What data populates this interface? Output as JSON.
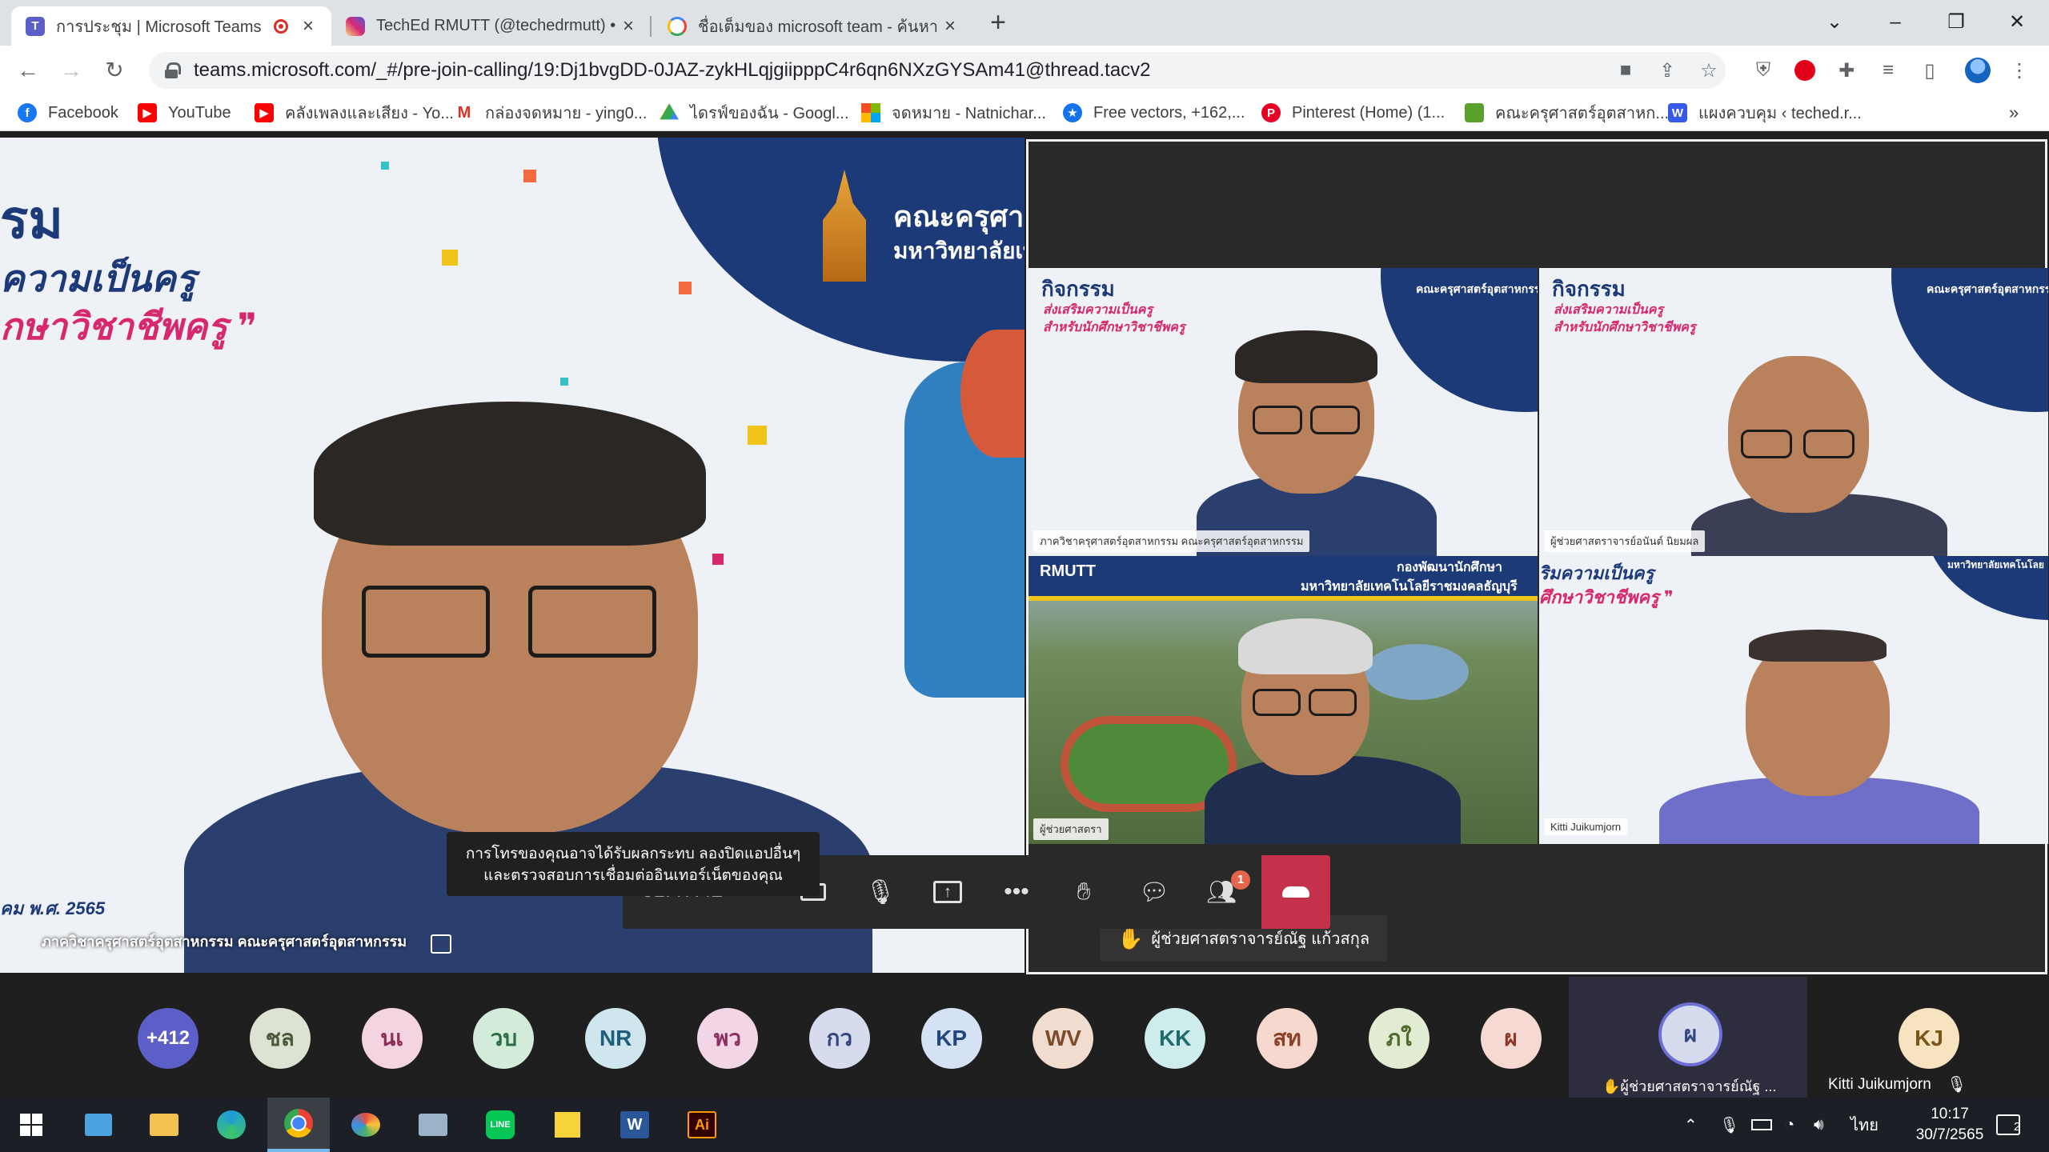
{
  "browser": {
    "tabs": [
      {
        "title": "การประชุม | Microsoft Teams",
        "icon": "teams-icon"
      },
      {
        "title": "TechEd RMUTT (@techedrmutt) •",
        "icon": "instagram-icon"
      },
      {
        "title": "ชื่อเต็มของ microsoft team - ค้นหา",
        "icon": "google-icon"
      }
    ],
    "url": "teams.microsoft.com/_#/pre-join-calling/19:Dj1bvgDD-0JAZ-zykHLqjgiipppC4r6qn6NXzGYSAm41@thread.tacv2",
    "bookmarks": [
      {
        "label": "Facebook",
        "icon": "facebook-icon",
        "color": "#1877f2"
      },
      {
        "label": "YouTube",
        "icon": "youtube-icon",
        "color": "#ff0000"
      },
      {
        "label": "คลังเพลงและเสียง - Yo...",
        "icon": "youtube-icon",
        "color": "#ff0000"
      },
      {
        "label": "กล่องจดหมาย - ying0...",
        "icon": "gmail-icon",
        "color": "#d93025"
      },
      {
        "label": "ไดรฟ์ของฉัน - Googl...",
        "icon": "google-drive-icon",
        "color": "#1fa463"
      },
      {
        "label": "จดหมาย - Natnichar...",
        "icon": "microsoft-icon",
        "color": "#f25022"
      },
      {
        "label": "Free vectors, +162,...",
        "icon": "freepik-icon",
        "color": "#1273eb"
      },
      {
        "label": "Pinterest (Home) (1...",
        "icon": "pinterest-icon",
        "color": "#e60023"
      },
      {
        "label": "คณะครุศาสตร์อุตสาหก...",
        "icon": "bookmark-page-icon",
        "color": "#5aa02c"
      },
      {
        "label": "แผงควบคุม ‹ teched.r...",
        "icon": "wordpress-icon",
        "color": "#3858e9"
      }
    ],
    "more_bookmarks": "»"
  },
  "meeting": {
    "speaker_name": "ภาควิชาครุศาสตร์อุตสาหกรรม คณะครุศาสตร์อุตสาหกรรม",
    "speaker_poster": {
      "title_fragment": "รม",
      "quote_line1": "ความเป็นครู",
      "quote_line2": "กษาวิชาชีพครู ❞",
      "faculty": "คณะครุศาสตร",
      "university": "มหาวิทยาลัยเทค",
      "date_fragment": "คม พ.ศ. 2565"
    },
    "gallery": [
      {
        "name": "ภาควิชาครุศาสตร์อุตสาหกรรม คณะครุศาสตร์อุตสาหกรรม"
      },
      {
        "name": "ผู้ช่วยศาสตราจารย์อนันต์ นิยมผล"
      },
      {
        "name": "ผู้ช่วยศาสตรา"
      },
      {
        "name": "Kitti Juikumjorn"
      }
    ],
    "gallery_poster": {
      "title": "กิจกรรม",
      "quote_line1": "ส่งเสริมความเป็นครู",
      "quote_line2": "สำหรับนักศึกษาวิชาชีพครู",
      "faculty": "คณะครุศาสตร์อุตสาหกรรม",
      "rmutt_label": "RMUTT",
      "rmutt_dept": "กองพัฒนานักศึกษา",
      "rmutt_university": "มหาวิทยาลัยเทคโนโลยีราชมงคลธัญบุรี",
      "tile4_line1": "ริมความเป็นครู",
      "tile4_line2": "ศึกษาวิชาชีพครู ❞",
      "tile4_faculty": "มหาวิทยาลัยเทคโนโลย"
    },
    "raise_hand_toast": "ผู้ช่วยศาสตราจารย์ณัฐ แก้วสกุล",
    "network_tooltip_line1": "การโทรของคุณอาจได้รับผลกระทบ ลองปิดแอปอื่นๆ",
    "network_tooltip_line2": "และตรวจสอบการเชื่อมต่ออินเทอร์เน็ตของคุณ",
    "timer": "01:47:42",
    "participants_badge": "1"
  },
  "participants": [
    {
      "initials": "+412",
      "bg": "#5b5fc7",
      "fg": "#ffffff"
    },
    {
      "initials": "ชล",
      "bg": "#dde3d2",
      "fg": "#4a5a3b"
    },
    {
      "initials": "นเ",
      "bg": "#f5d4e1",
      "fg": "#8a2d57"
    },
    {
      "initials": "วบ",
      "bg": "#d3ebd9",
      "fg": "#2f6b45"
    },
    {
      "initials": "NR",
      "bg": "#cfe6ef",
      "fg": "#1d5f7a"
    },
    {
      "initials": "พว",
      "bg": "#f3d6e6",
      "fg": "#8c2f62"
    },
    {
      "initials": "กว",
      "bg": "#d6dcee",
      "fg": "#34467f"
    },
    {
      "initials": "KP",
      "bg": "#d5e2f5",
      "fg": "#22467f"
    },
    {
      "initials": "WV",
      "bg": "#f0ddd0",
      "fg": "#7d4a2a"
    },
    {
      "initials": "KK",
      "bg": "#cfecec",
      "fg": "#1f6b6b"
    },
    {
      "initials": "สท",
      "bg": "#f6d8cf",
      "fg": "#8a3f27"
    },
    {
      "initials": "ภใ",
      "bg": "#e1ecd2",
      "fg": "#4c6a2a"
    },
    {
      "initials": "ผ",
      "bg": "#f6d9d3",
      "fg": "#8d3626"
    }
  ],
  "selected_participant": {
    "initials": "ผ",
    "caption": "ผู้ช่วยศาสตราจารย์ณัฐ ..."
  },
  "last_participant": {
    "initials": "KJ",
    "name": "Kitti Juikumjorn"
  },
  "taskbar": {
    "apps": [
      "start-icon",
      "news-icon",
      "file-explorer-icon",
      "edge-icon",
      "chrome-icon",
      "paint-icon",
      "photos-icon",
      "line-icon",
      "sticky-notes-icon",
      "word-icon",
      "illustrator-icon"
    ],
    "language": "ไทย",
    "time": "10:17",
    "date": "30/7/2565",
    "notifications": "2"
  }
}
